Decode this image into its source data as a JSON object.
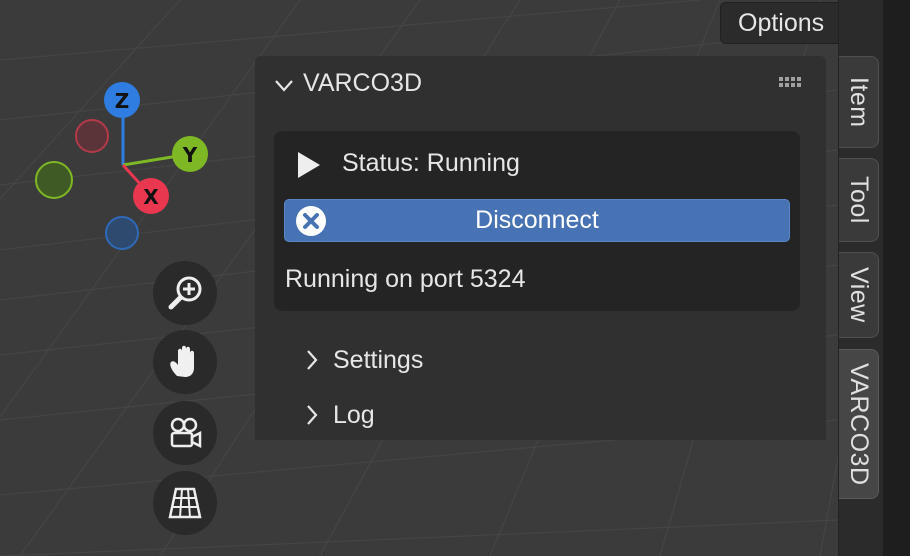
{
  "options": {
    "label": "Options"
  },
  "panel": {
    "title": "VARCO3D",
    "status": "Status: Running",
    "disconnect_label": "Disconnect",
    "port_text": "Running on port 5324",
    "subpanels": [
      {
        "label": "Settings"
      },
      {
        "label": "Log"
      }
    ]
  },
  "tabs": [
    {
      "label": "Item"
    },
    {
      "label": "Tool"
    },
    {
      "label": "View"
    },
    {
      "label": "VARCO3D",
      "active": true
    }
  ],
  "gizmo": {
    "axes": [
      {
        "label": "Z",
        "color": "#2f7de0"
      },
      {
        "label": "Y",
        "color": "#7fb825"
      },
      {
        "label": "X",
        "color": "#e8374f"
      }
    ]
  },
  "nav_buttons": [
    {
      "icon": "zoom-icon"
    },
    {
      "icon": "pan-hand-icon"
    },
    {
      "icon": "camera-icon"
    },
    {
      "icon": "perspective-grid-icon"
    }
  ],
  "colors": {
    "accent_button": "#4772b3",
    "panel_bg": "#303030",
    "box_bg": "#242424"
  }
}
